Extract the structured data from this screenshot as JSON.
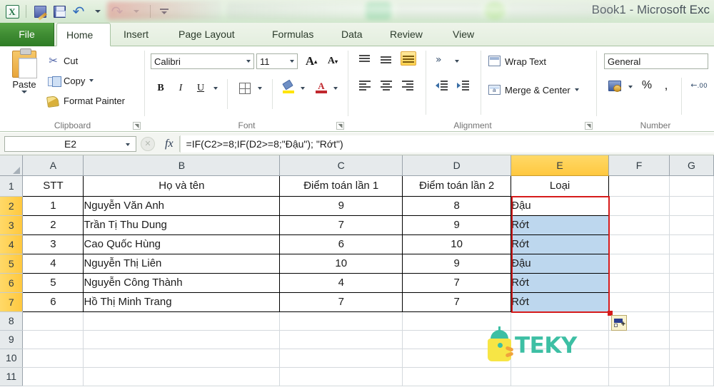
{
  "window": {
    "title": "Book1  -  Microsoft Exc",
    "app_logo": "excel-logo-icon"
  },
  "quick_access": {
    "items": [
      {
        "name": "excel-logo-icon",
        "label": "X"
      },
      {
        "name": "customize-edit-icon",
        "label": ""
      },
      {
        "name": "save-icon",
        "label": ""
      },
      {
        "name": "undo-icon",
        "label": "↶"
      },
      {
        "name": "redo-icon",
        "label": "↷"
      },
      {
        "name": "customize-qat-icon",
        "label": ""
      }
    ]
  },
  "ribbon": {
    "tabs": [
      {
        "label": "File",
        "active": false
      },
      {
        "label": "Home",
        "active": true
      },
      {
        "label": "Insert",
        "active": false
      },
      {
        "label": "Page Layout",
        "active": false
      },
      {
        "label": "Formulas",
        "active": false
      },
      {
        "label": "Data",
        "active": false
      },
      {
        "label": "Review",
        "active": false
      },
      {
        "label": "View",
        "active": false
      }
    ],
    "clipboard": {
      "group_label": "Clipboard",
      "paste_label": "Paste",
      "cut_label": "Cut",
      "copy_label": "Copy",
      "format_painter_label": "Format Painter"
    },
    "font": {
      "group_label": "Font",
      "font_family": "Calibri",
      "font_size": "11",
      "grow_label": "A",
      "shrink_label": "A",
      "bold_label": "B",
      "italic_label": "I",
      "underline_label": "U",
      "borders_label": "",
      "fill_color_label": "",
      "font_color_label": "A"
    },
    "alignment": {
      "group_label": "Alignment",
      "wrap_text_label": "Wrap Text",
      "merge_center_label": "Merge & Center",
      "orientation_label": "»"
    },
    "number": {
      "group_label": "Number",
      "format_value": "General",
      "percent_label": "%",
      "comma_label": ",",
      "decrease_decimal_label": ".00"
    }
  },
  "formula_bar": {
    "name_box": "E2",
    "fx_label": "fx",
    "formula": "=IF(C2>=8;IF(D2>=8;\"Đậu\"); \"Rớt\")"
  },
  "sheet": {
    "column_headers": [
      "A",
      "B",
      "C",
      "D",
      "E",
      "F",
      "G"
    ],
    "active_column": "E",
    "row_headers": [
      "1",
      "2",
      "3",
      "4",
      "5",
      "6",
      "7",
      "8",
      "9",
      "10",
      "11"
    ],
    "active_rows": [
      "2",
      "3",
      "4",
      "5",
      "6",
      "7"
    ],
    "table_header": [
      "STT",
      "Họ và tên",
      "Điểm toán lần 1",
      "Điểm toán lần 2",
      "Loại"
    ],
    "rows": [
      {
        "stt": "1",
        "name": "Nguyễn Văn Anh",
        "diem1": "9",
        "diem2": "8",
        "loai": "Đậu"
      },
      {
        "stt": "2",
        "name": "Trần Tị Thu Dung",
        "diem1": "7",
        "diem2": "9",
        "loai": "Rớt"
      },
      {
        "stt": "3",
        "name": "Cao Quốc Hùng",
        "diem1": "6",
        "diem2": "10",
        "loai": "Rớt"
      },
      {
        "stt": "4",
        "name": "Nguyễn Thị Liên",
        "diem1": "10",
        "diem2": "9",
        "loai": "Đậu"
      },
      {
        "stt": "5",
        "name": "Nguyễn Công Thành",
        "diem1": "4",
        "diem2": "7",
        "loai": "Rớt"
      },
      {
        "stt": "6",
        "name": "Hồ Thị Minh Trang",
        "diem1": "7",
        "diem2": "7",
        "loai": "Rớt"
      }
    ],
    "selection": {
      "range": "E2:E7",
      "border_color": "#d61b1b",
      "fill_color": "#bdd7ee"
    },
    "smart_tag": "auto-fill-options-icon"
  },
  "watermark": {
    "text": "TEKY",
    "color": "#3dbfa4"
  }
}
